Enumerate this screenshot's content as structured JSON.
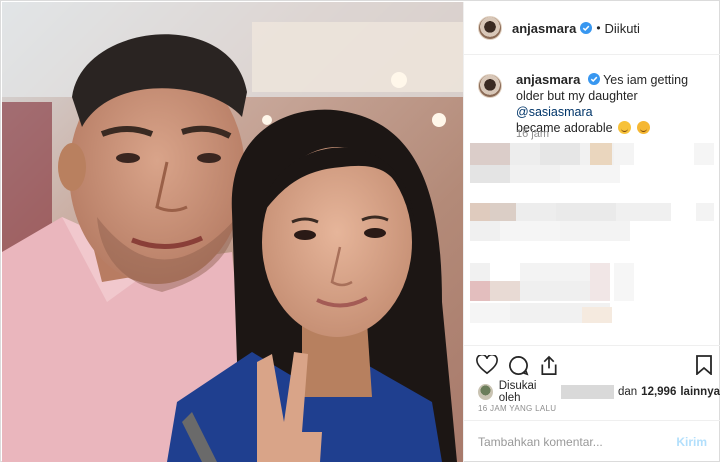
{
  "post": {
    "username": "anjasmara",
    "separator": "•",
    "follow_status": "Diikuti",
    "caption": {
      "text_before_mention": "Yes iam getting older but my daughter",
      "mention": "@sasiasmara",
      "text_after_mention": "became adorable"
    },
    "caption_time": "16 jam",
    "likes": {
      "prefix": "Disukai oleh",
      "connector": "dan",
      "count": "12,996",
      "suffix": "lainnya"
    },
    "posted_ago": "16 JAM YANG LALU",
    "comment_input": {
      "placeholder": "Tambahkan komentar..."
    },
    "send_label": "Kirim"
  },
  "icons": {
    "verified": "verified-badge-icon",
    "like": "heart-icon",
    "comment": "comment-bubble-icon",
    "share": "share-icon",
    "save": "bookmark-icon"
  },
  "colors": {
    "verified_blue": "#3897f0",
    "mention": "#003569",
    "muted": "#8e8e8e",
    "send_disabled": "#b2dffc"
  }
}
